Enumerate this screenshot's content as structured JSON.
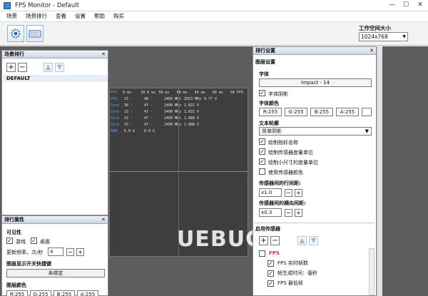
{
  "window": {
    "title": "FPS Monitor - Default",
    "minimize": "—",
    "maximize": "☐",
    "close": "✕"
  },
  "menu": [
    "场景",
    "场景排行",
    "查看",
    "设置",
    "帮助",
    "购买"
  ],
  "toolbar": {
    "workspace_label": "工作空间大小",
    "workspace_value": "1024x768"
  },
  "scene_panel": {
    "title": "场景排行",
    "close": "✕",
    "add": "+",
    "remove": "−",
    "up": "▲",
    "down": "▼",
    "items": [
      "DEFAULT"
    ]
  },
  "props_panel": {
    "title": "排行属性",
    "close": "✕",
    "visibility_label": "可见性",
    "game_label": "游戏",
    "desktop_label": "桌面",
    "update_label": "更新频率，次/秒",
    "update_value": "4",
    "minus": "−",
    "plus": "+",
    "hotkey_label": "图层显示开关快捷键",
    "hotkey_value": "未绑定",
    "color_label": "图层颜色",
    "color_values": [
      "R:255",
      "G:255",
      "B:255",
      "A:255"
    ]
  },
  "settings_panel": {
    "title": "排行设置",
    "close": "✕",
    "section_general": "图层设置",
    "font_label": "字体",
    "font_value": "Impact - 14",
    "font_shadow": "字体阴影",
    "font_color_label": "字体颜色",
    "font_color": [
      "R:255",
      "G:255",
      "B:255",
      "A:255"
    ],
    "outline_label": "文本轮廓",
    "outline_value": "简单阴影",
    "checks": [
      "绘制指标名称",
      "绘制传感器度量单位",
      "绘制小尺寸的度量单位",
      "使用传感器颜色"
    ],
    "checks_state": [
      true,
      true,
      true,
      false
    ],
    "row_spacing_label": "传感器间的行间距:",
    "row_spacing_value": "x1.0",
    "col_spacing_label": "传感器间的横向间距:",
    "col_spacing_value": "x0.3",
    "minus": "−",
    "plus": "+",
    "sensors_label": "启用传感器",
    "sensor_tree": [
      {
        "label": "FPS",
        "level": 0,
        "checked": false,
        "red": true
      },
      {
        "label": "FPS 实时帧数",
        "level": 1,
        "checked": true
      },
      {
        "label": "帧生成时间：毫秒",
        "level": 1,
        "checked": true
      },
      {
        "label": "FPS 最低帧",
        "level": 1,
        "checked": true
      }
    ]
  },
  "osd": {
    "rows": [
      {
        "name": "FPS",
        "values": [
          "0 ms",
          "20.0 ms",
          "50 ms",
          "58 ms",
          "50 ms",
          "50 ms",
          "58 FPS"
        ]
      },
      {
        "name": "CPU",
        "values": [
          "15 ·",
          "48 ·",
          "2490 MHz",
          "2013 MHz",
          "9.77 V"
        ]
      },
      {
        "name": "Core",
        "values": [
          "36 ·",
          "47 ·",
          "2490 MHz",
          "1.021 V"
        ]
      },
      {
        "name": "Core",
        "values": [
          "15 ·",
          "47 ·",
          "2490 MHz",
          "1.021 V"
        ]
      },
      {
        "name": "Core",
        "values": [
          "15 ·",
          "47 ·",
          "2490 MHz",
          "1.088 V"
        ]
      },
      {
        "name": "Core",
        "values": [
          "15 ·",
          "47 ·",
          "2490 MHz",
          "1.088 V"
        ]
      },
      {
        "name": "RAM",
        "values": [
          "6.0 G",
          "8.0 G"
        ]
      }
    ]
  },
  "watermark": "UEBUG"
}
